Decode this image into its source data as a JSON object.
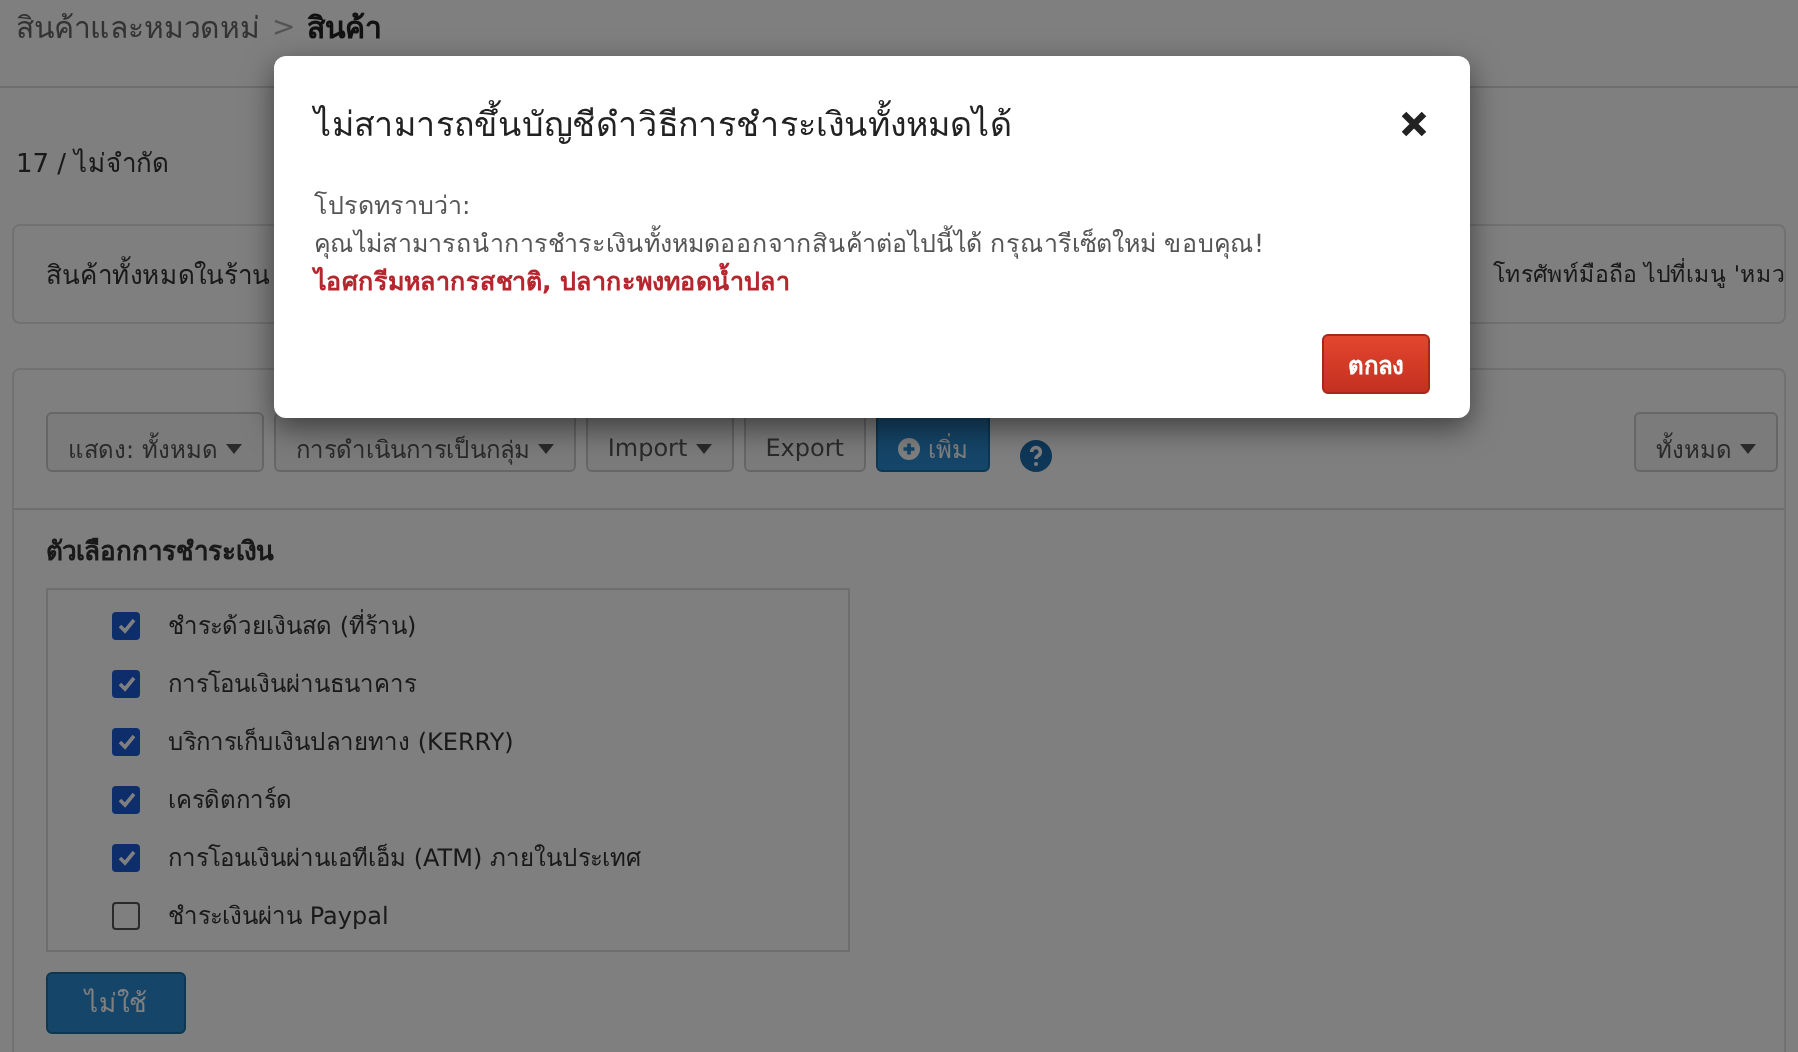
{
  "breadcrumb": {
    "parent": "สินค้าและหมวดหม่",
    "separator": ">",
    "current": "สินค้า"
  },
  "quota": "17 / ไม่จำกัด",
  "info": {
    "left": "สินค้าทั้งหมดในร้าน",
    "right": "โทรศัพท์มือถือ ไปที่เมนู 'หมว"
  },
  "toolbar": [
    {
      "kind": "dropdown",
      "label": "แสดง: ทั้งหมด"
    },
    {
      "kind": "dropdown",
      "label": "การดำเนินการเป็นกลุ่ม"
    },
    {
      "kind": "dropdown",
      "label": "Import"
    },
    {
      "kind": "button",
      "label": "Export"
    },
    {
      "kind": "primary",
      "label": "เพิ่ม"
    }
  ],
  "filter": {
    "label": "ทั้งหมด"
  },
  "section_title": "ตัวเลือกการชำระเงิน",
  "payment_options": [
    {
      "label": "ชำระด้วยเงินสด (ที่ร้าน)",
      "checked": true
    },
    {
      "label": "การโอนเงินผ่านธนาคาร",
      "checked": true
    },
    {
      "label": "บริการเก็บเงินปลายทาง (KERRY)",
      "checked": true
    },
    {
      "label": "เครดิตการ์ด",
      "checked": true
    },
    {
      "label": "การโอนเงินผ่านเอทีเอ็ม (ATM) ภายในประเทศ",
      "checked": true
    },
    {
      "label": "ชำระเงินผ่าน Paypal",
      "checked": false
    }
  ],
  "disable_button": "ไม่ใช้",
  "modal": {
    "title": "ไม่สามารถขึ้นบัญชีดำวิธีการชำระเงินทั้งหมดได้",
    "intro": "โปรดทราบว่า:",
    "message": "คุณไม่สามารถนำการชำระเงินทั้งหมดออกจากสินค้าต่อไปนี้ได้ กรุณารีเซ็ตใหม่ ขอบคุณ!",
    "products": "ไอศกรีมหลากรสชาติ, ปลากะพงทอดน้ำปลา",
    "ok": "ตกลง"
  }
}
